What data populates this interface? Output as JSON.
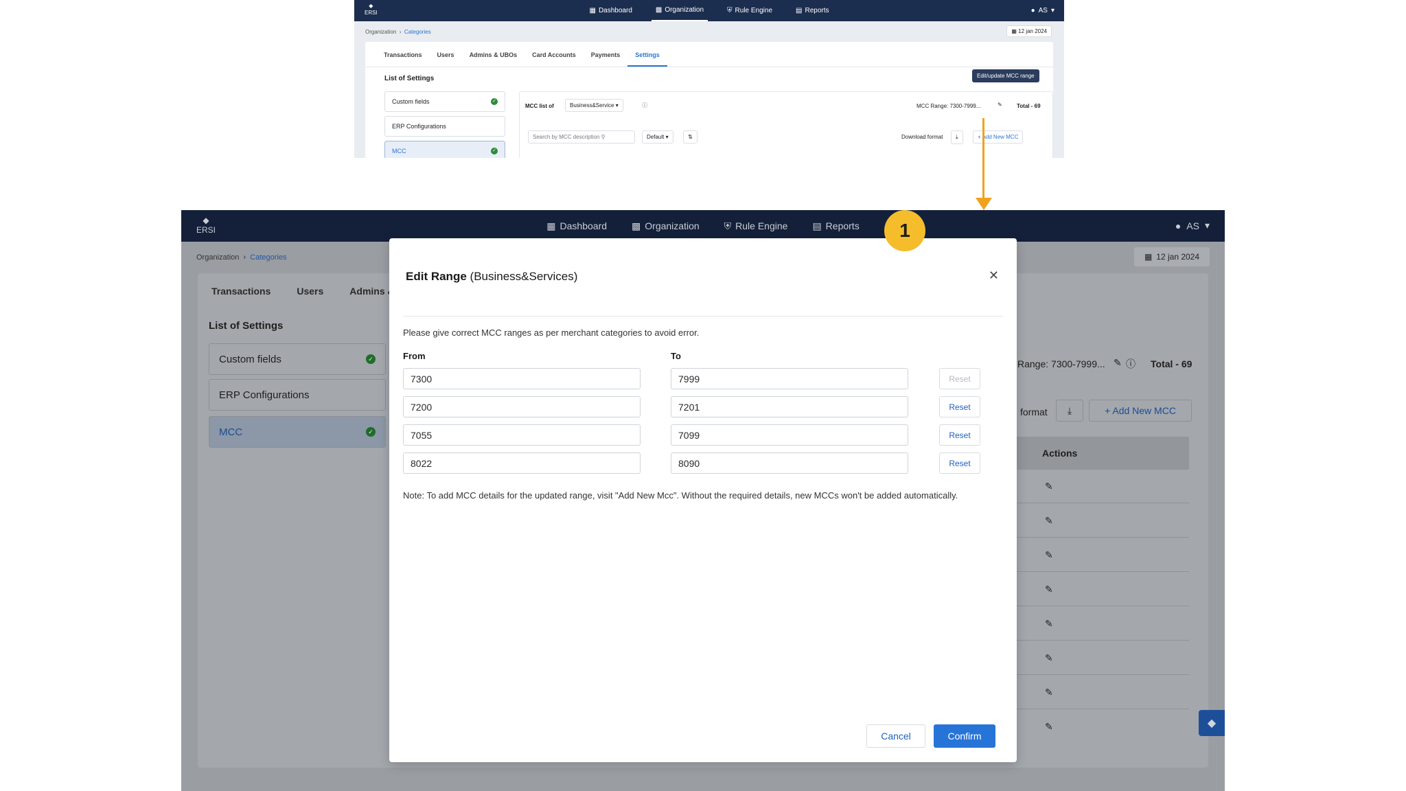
{
  "top": {
    "nav": [
      "Dashboard",
      "Organization",
      "Rule Engine",
      "Reports"
    ],
    "logo": "ERSI",
    "user": "AS",
    "breadcrumb": [
      "Organization",
      "Categories"
    ],
    "date": "12 jan 2024",
    "tabs": [
      "Transactions",
      "Users",
      "Admins & UBOs",
      "Card Accounts",
      "Payments",
      "Settings"
    ],
    "list_title": "List of Settings",
    "settings": [
      "Custom fields",
      "ERP Configurations",
      "MCC"
    ],
    "mcc_list_label": "MCC list of",
    "mcc_list_value": "Business&Service",
    "mcc_range": "MCC Range: 7300-7999...",
    "total": "Total - 69",
    "tooltip": "Edit/update MCC range",
    "search_placeholder": "Search by MCC description",
    "sort": "Default",
    "download_format": "Download format",
    "add_new": "Add New MCC"
  },
  "big": {
    "nav": [
      "Dashboard",
      "Organization",
      "Rule Engine",
      "Reports"
    ],
    "logo": "ERSI",
    "user": "AS",
    "breadcrumb": [
      "Organization",
      "Categories"
    ],
    "date": "12 jan 2024",
    "tabs": [
      "Transactions",
      "Users",
      "Admins & U"
    ],
    "list_title": "List of Settings",
    "settings": [
      "Custom fields",
      "ERP Configurations",
      "MCC"
    ],
    "range_text": "Range: 7300-7999...",
    "total": "Total - 69",
    "format_text": "format",
    "add_new": "+ Add New MCC",
    "actions_header": "Actions"
  },
  "modal": {
    "title_bold": "Edit Range",
    "title_rest": "(Business&Services)",
    "hint": "Please give correct MCC ranges as per merchant categories to avoid error.",
    "from_label": "From",
    "to_label": "To",
    "rows": [
      {
        "from": "7300",
        "to": "7999",
        "reset": "Reset"
      },
      {
        "from": "7200",
        "to": "7201",
        "reset": "Reset"
      },
      {
        "from": "7055",
        "to": "7099",
        "reset": "Reset"
      },
      {
        "from": "8022",
        "to": "8090",
        "reset": "Reset"
      }
    ],
    "note": "Note: To add MCC details for the updated range, visit \"Add New Mcc\". Without the required details, new MCCs won't be added automatically.",
    "cancel": "Cancel",
    "confirm": "Confirm"
  },
  "step": "1",
  "colors": {
    "accent": "#2774d8",
    "navbar": "#1c2e4f",
    "badge": "#f5bd2b",
    "arrow": "#f0a21c"
  }
}
